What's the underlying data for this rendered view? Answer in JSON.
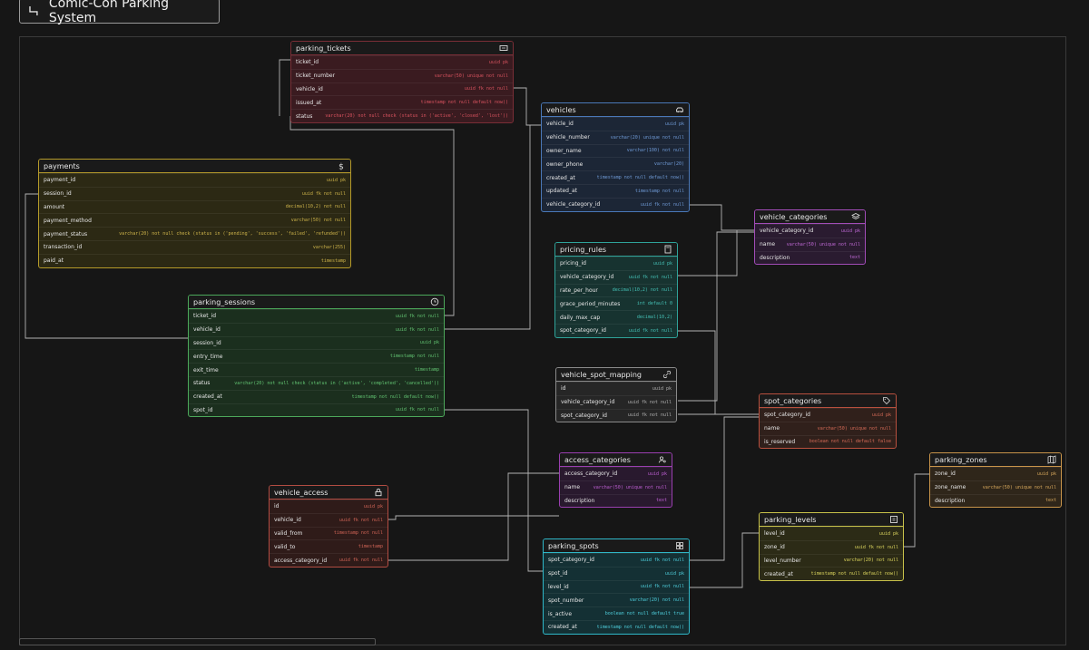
{
  "app": {
    "title": "Comic-Con Parking System"
  },
  "tables": [
    {
      "id": "parking_tickets",
      "name": "parking_tickets",
      "icon": "ticket-icon",
      "border": "#7a2e36",
      "bg": "#3a1b20",
      "type_color": "#d9535f",
      "columns": [
        {
          "name": "ticket_id",
          "type": "uuid pk"
        },
        {
          "name": "ticket_number",
          "type": "varchar(50) unique not null"
        },
        {
          "name": "vehicle_id",
          "type": "uuid fk not null"
        },
        {
          "name": "issued_at",
          "type": "timestamp not null default now()"
        },
        {
          "name": "status",
          "type": "varchar(20) not null check (status in ('active', 'closed', 'lost'))"
        }
      ]
    },
    {
      "id": "vehicles",
      "name": "vehicles",
      "icon": "car-icon",
      "border": "#4a78b8",
      "bg": "#1c2636",
      "type_color": "#6f9ad6",
      "columns": [
        {
          "name": "vehicle_id",
          "type": "uuid pk"
        },
        {
          "name": "vehicle_number",
          "type": "varchar(20) unique not null"
        },
        {
          "name": "owner_name",
          "type": "varchar(100) not null"
        },
        {
          "name": "owner_phone",
          "type": "varchar(20)"
        },
        {
          "name": "created_at",
          "type": "timestamp not null default now()"
        },
        {
          "name": "updated_at",
          "type": "timestamp not null"
        },
        {
          "name": "vehicle_category_id",
          "type": "uuid fk not null"
        }
      ]
    },
    {
      "id": "payments",
      "name": "payments",
      "icon": "dollar-icon",
      "border": "#b59a2a",
      "bg": "#2c2914",
      "type_color": "#cdb34a",
      "columns": [
        {
          "name": "payment_id",
          "type": "uuid pk"
        },
        {
          "name": "session_id",
          "type": "uuid fk not null"
        },
        {
          "name": "amount",
          "type": "decimal(10,2) not null"
        },
        {
          "name": "payment_method",
          "type": "varchar(50) not null"
        },
        {
          "name": "payment_status",
          "type": "varchar(20) not null check (status in ('pending', 'success', 'failed', 'refunded'))"
        },
        {
          "name": "transaction_id",
          "type": "varchar(255)"
        },
        {
          "name": "paid_at",
          "type": "timestamp"
        }
      ]
    },
    {
      "id": "vehicle_categories",
      "name": "vehicle_categories",
      "icon": "layers-icon",
      "border": "#a24cb8",
      "bg": "#2a1b30",
      "type_color": "#c069d6",
      "columns": [
        {
          "name": "vehicle_category_id",
          "type": "uuid pk"
        },
        {
          "name": "name",
          "type": "varchar(50) unique not null"
        },
        {
          "name": "description",
          "type": "text"
        }
      ]
    },
    {
      "id": "pricing_rules",
      "name": "pricing_rules",
      "icon": "calculator-icon",
      "border": "#2fa39a",
      "bg": "#173330",
      "type_color": "#45c1b6",
      "columns": [
        {
          "name": "pricing_id",
          "type": "uuid pk"
        },
        {
          "name": "vehicle_category_id",
          "type": "uuid fk not null"
        },
        {
          "name": "rate_per_hour",
          "type": "decimal(10,2) not null"
        },
        {
          "name": "grace_period_minutes",
          "type": "int default 0"
        },
        {
          "name": "daily_max_cap",
          "type": "decimal(10,2)"
        },
        {
          "name": "spot_category_id",
          "type": "uuid fk not null"
        }
      ]
    },
    {
      "id": "parking_sessions",
      "name": "parking_sessions",
      "icon": "clock-icon",
      "border": "#4ca85a",
      "bg": "#1b2f1e",
      "type_color": "#62c472",
      "columns": [
        {
          "name": "ticket_id",
          "type": "uuid fk not null"
        },
        {
          "name": "vehicle_id",
          "type": "uuid fk not null"
        },
        {
          "name": "session_id",
          "type": "uuid pk"
        },
        {
          "name": "entry_time",
          "type": "timestamp not null"
        },
        {
          "name": "exit_time",
          "type": "timestamp"
        },
        {
          "name": "status",
          "type": "varchar(20) not null check (status in ('active', 'completed', 'cancelled'))"
        },
        {
          "name": "created_at",
          "type": "timestamp not null default now()"
        },
        {
          "name": "spot_id",
          "type": "uuid fk not null"
        }
      ]
    },
    {
      "id": "vehicle_spot_mapping",
      "name": "vehicle_spot_mapping",
      "icon": "link-icon",
      "border": "#8a8a8a",
      "bg": "#262626",
      "type_color": "#b0b0b0",
      "columns": [
        {
          "name": "id",
          "type": "uuid pk"
        },
        {
          "name": "vehicle_category_id",
          "type": "uuid fk not null"
        },
        {
          "name": "spot_category_id",
          "type": "uuid fk not null"
        }
      ]
    },
    {
      "id": "spot_categories",
      "name": "spot_categories",
      "icon": "tag-icon",
      "border": "#b8503e",
      "bg": "#30201b",
      "type_color": "#d76b57",
      "columns": [
        {
          "name": "spot_category_id",
          "type": "uuid pk"
        },
        {
          "name": "name",
          "type": "varchar(50) unique not null"
        },
        {
          "name": "is_reserved",
          "type": "boolean not null default false"
        }
      ]
    },
    {
      "id": "access_categories",
      "name": "access_categories",
      "icon": "user-search-icon",
      "border": "#9a3fb0",
      "bg": "#29192e",
      "type_color": "#bf5fd4",
      "columns": [
        {
          "name": "access_category_id",
          "type": "uuid pk"
        },
        {
          "name": "name",
          "type": "varchar(50) unique not null"
        },
        {
          "name": "description",
          "type": "text"
        }
      ]
    },
    {
      "id": "parking_zones",
      "name": "parking_zones",
      "icon": "map-icon",
      "border": "#c8944a",
      "bg": "#2f261a",
      "type_color": "#d9a95c",
      "columns": [
        {
          "name": "zone_id",
          "type": "uuid pk"
        },
        {
          "name": "zone_name",
          "type": "varchar(50) unique not null"
        },
        {
          "name": "description",
          "type": "text"
        }
      ]
    },
    {
      "id": "vehicle_access",
      "name": "vehicle_access",
      "icon": "lock-icon",
      "border": "#b24c42",
      "bg": "#2f1b19",
      "type_color": "#d26557",
      "columns": [
        {
          "name": "id",
          "type": "uuid pk"
        },
        {
          "name": "vehicle_id",
          "type": "uuid fk not null"
        },
        {
          "name": "valid_from",
          "type": "timestamp not null"
        },
        {
          "name": "valid_to",
          "type": "timestamp"
        },
        {
          "name": "access_category_id",
          "type": "uuid fk not null"
        }
      ]
    },
    {
      "id": "parking_levels",
      "name": "parking_levels",
      "icon": "building-icon",
      "border": "#c8c24a",
      "bg": "#2c2b16",
      "type_color": "#ddd65e",
      "columns": [
        {
          "name": "level_id",
          "type": "uuid pk"
        },
        {
          "name": "zone_id",
          "type": "uuid fk not null"
        },
        {
          "name": "level_number",
          "type": "varchar(20) not null"
        },
        {
          "name": "created_at",
          "type": "timestamp not null default now()"
        }
      ]
    },
    {
      "id": "parking_spots",
      "name": "parking_spots",
      "icon": "grid-icon",
      "border": "#2fb8c8",
      "bg": "#143034",
      "type_color": "#4fd0de",
      "columns": [
        {
          "name": "spot_category_id",
          "type": "uuid fk not null"
        },
        {
          "name": "spot_id",
          "type": "uuid pk"
        },
        {
          "name": "level_id",
          "type": "uuid fk not null"
        },
        {
          "name": "spot_number",
          "type": "varchar(20) not null"
        },
        {
          "name": "is_active",
          "type": "boolean not null default true"
        },
        {
          "name": "created_at",
          "type": "timestamp not null default now()"
        }
      ]
    }
  ]
}
